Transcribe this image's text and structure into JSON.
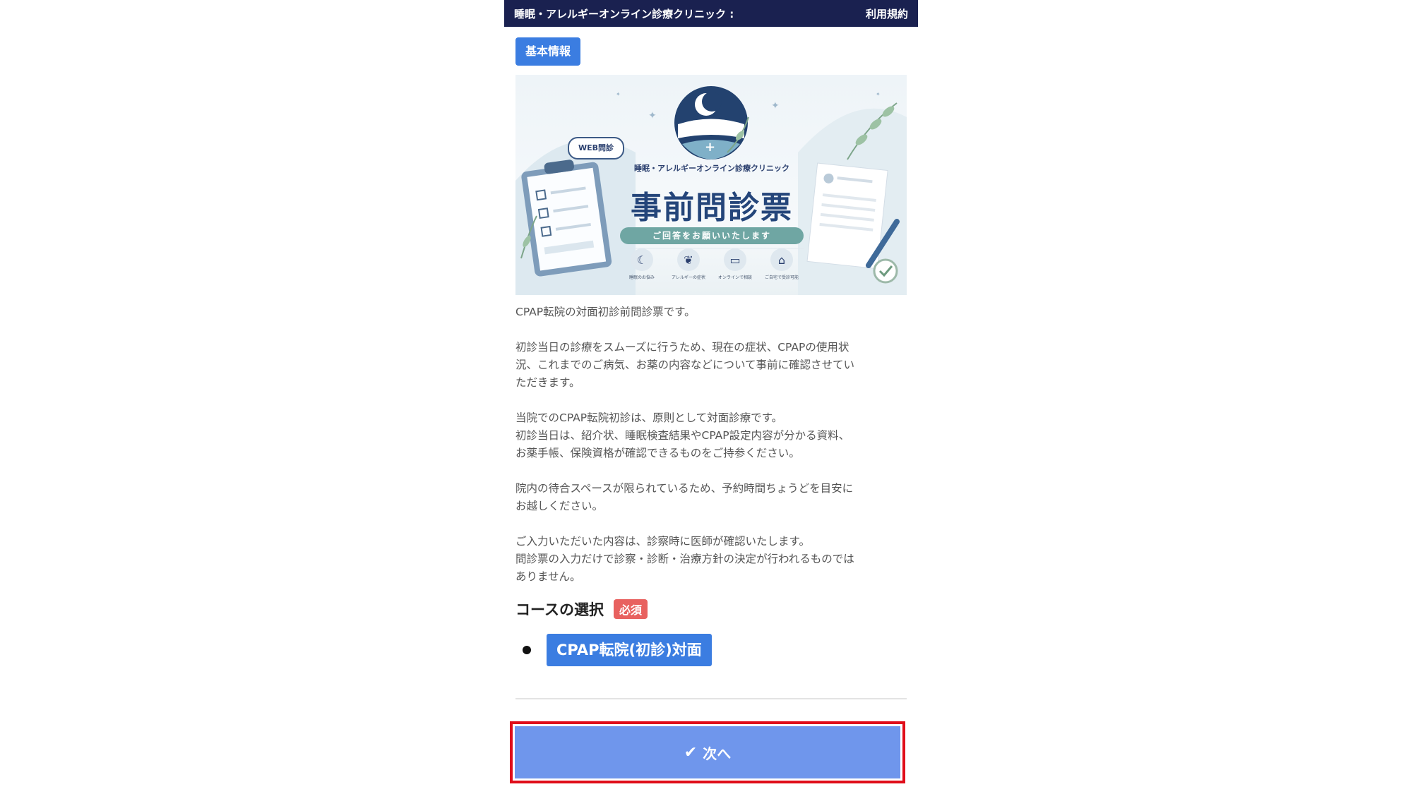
{
  "header": {
    "title": "睡眠・アレルギーオンライン診療クリニック :",
    "terms_link": "利用規約"
  },
  "info_badge": "基本情報",
  "banner": {
    "web_bubble": "WEB問診",
    "clinic_name": "睡眠・アレルギーオンライン診療クリニック",
    "title": "事前問診票",
    "pill": "ご回答をお願いいたします",
    "icons": [
      {
        "icon": "moon-icon",
        "caption": "睡眠のお悩み"
      },
      {
        "icon": "plant-icon",
        "caption": "アレルギーの症状"
      },
      {
        "icon": "laptop-icon",
        "caption": "オンラインで相談"
      },
      {
        "icon": "house-icon",
        "caption": "ご自宅で受診可能"
      }
    ]
  },
  "paragraphs": [
    "CPAP転院の対面初診前問診票です。",
    "初診当日の診療をスムーズに行うため、現在の症状、CPAPの使用状\n況、これまでのご病気、お薬の内容などについて事前に確認させてい\nただきます。",
    "当院でのCPAP転院初診は、原則として対面診療です。\n初診当日は、紹介状、睡眠検査結果やCPAP設定内容が分かる資料、\nお薬手帳、保険資格が確認できるものをご持参ください。",
    "院内の待合スペースが限られているため、予約時間ちょうどを目安に\nお越しください。",
    "ご入力いただいた内容は、診察時に医師が確認いたします。\n問診票の入力だけで診察・診断・治療方針の決定が行われるものでは\nありません。"
  ],
  "course": {
    "heading": "コースの選択",
    "required": "必須",
    "option": "CPAP転院(初診)対面",
    "selected": true
  },
  "next_button": "次へ",
  "colors": {
    "header_bg": "#1a2150",
    "accent": "#3b7de1",
    "required": "#e8615f",
    "next_bg": "#6f96ec",
    "highlight_border": "#e00d1a"
  }
}
